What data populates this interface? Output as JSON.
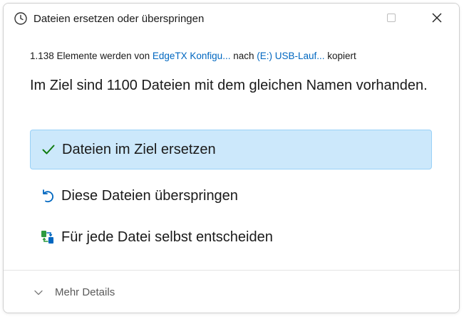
{
  "window": {
    "title": "Dateien ersetzen oder überspringen",
    "title_icon": "clock-icon",
    "controls": [
      "minimize-icon",
      "maximize-icon",
      "close-icon"
    ]
  },
  "copy_info": {
    "prefix": "1.138 Elemente werden von ",
    "source": "EdgeTX Konfigu...",
    "middle": " nach ",
    "destination": "(E:) USB-Lauf...",
    "suffix": " kopiert"
  },
  "headline": "Im Ziel sind 1100 Dateien mit dem gleichen Namen vorhanden.",
  "options": [
    {
      "label": "Dateien im Ziel ersetzen",
      "icon": "checkmark-icon",
      "selected": true
    },
    {
      "label": "Diese Dateien überspringen",
      "icon": "skip-undo-icon",
      "selected": false
    },
    {
      "label": "Für jede Datei selbst entscheiden",
      "icon": "compare-files-icon",
      "selected": false
    }
  ],
  "footer": {
    "details_label": "Mehr Details",
    "details_icon": "chevron-down-icon"
  },
  "colors": {
    "accent": "#0067c0",
    "selected_bg": "#cce8fb",
    "selected_border": "#99d1f7",
    "check_green": "#0f7b0f"
  }
}
